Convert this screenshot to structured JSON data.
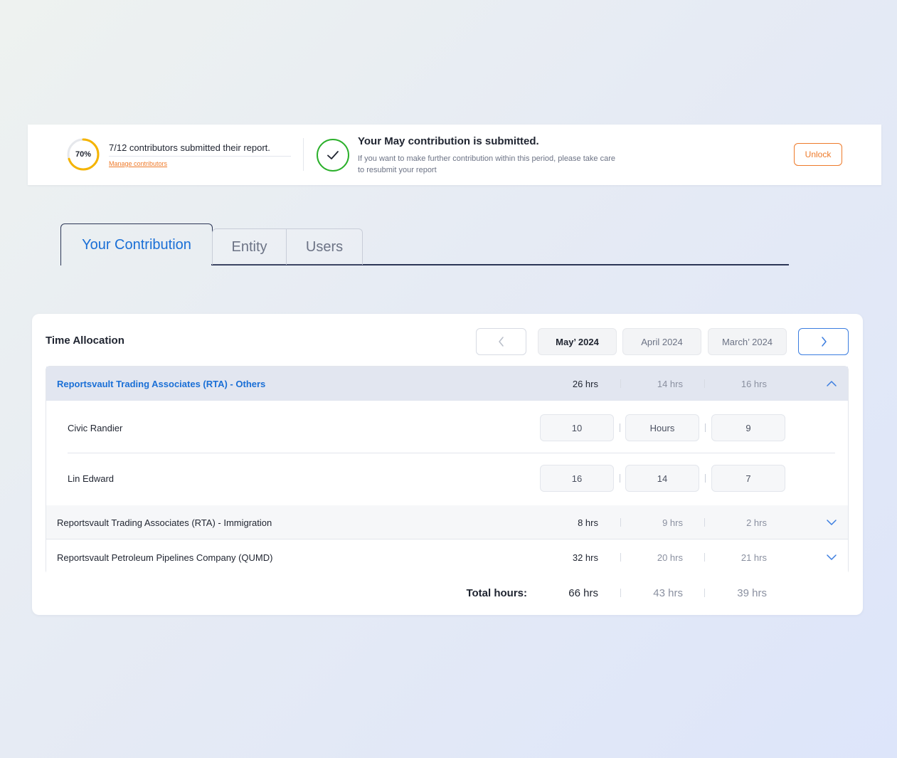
{
  "banner": {
    "progress_percent": 70,
    "progress_label": "70%",
    "contributors_summary": "7/12 contributors submitted their report.",
    "manage_link": "Manage contributors",
    "submitted_title": "Your May contribution is submitted.",
    "submitted_desc": "If you want to make further contribution within this period, please take care to resubmit your report",
    "unlock_label": "Unlock",
    "colors": {
      "progress": "#f5b400",
      "success": "#2bb02b",
      "accent": "#ee7a2a"
    }
  },
  "tabs": [
    {
      "label": "Your Contribution",
      "active": true
    },
    {
      "label": "Entity",
      "active": false
    },
    {
      "label": "Users",
      "active": false
    }
  ],
  "allocation": {
    "title": "Time Allocation",
    "prev_icon": "chevron-left-icon",
    "next_icon": "chevron-right-icon",
    "months": [
      {
        "label": "May’ 2024",
        "active": true
      },
      {
        "label": "April 2024",
        "active": false
      },
      {
        "label": "March’ 2024",
        "active": false
      }
    ],
    "entities": [
      {
        "name": "Reportsvault Trading Associates (RTA) - Others",
        "hours": [
          "26 hrs",
          "14 hrs",
          "16 hrs"
        ],
        "expanded": true,
        "people": [
          {
            "name": "Civic Randier",
            "values": [
              "10",
              "",
              "9"
            ],
            "placeholders": [
              "",
              "Hours",
              ""
            ]
          },
          {
            "name": "Lin Edward",
            "values": [
              "16",
              "14",
              "7"
            ],
            "placeholders": [
              "",
              "",
              ""
            ]
          }
        ]
      },
      {
        "name": "Reportsvault Trading Associates (RTA) - Immigration",
        "hours": [
          "8 hrs",
          "9 hrs",
          "2 hrs"
        ],
        "expanded": false
      },
      {
        "name": "Reportsvault Petroleum Pipelines Company (QUMD)",
        "hours": [
          "32 hrs",
          "20 hrs",
          "21 hrs"
        ],
        "expanded": false
      }
    ],
    "total_label": "Total hours:",
    "totals": [
      "66 hrs",
      "43 hrs",
      "39 hrs"
    ],
    "accent": "#1a6fd6"
  }
}
